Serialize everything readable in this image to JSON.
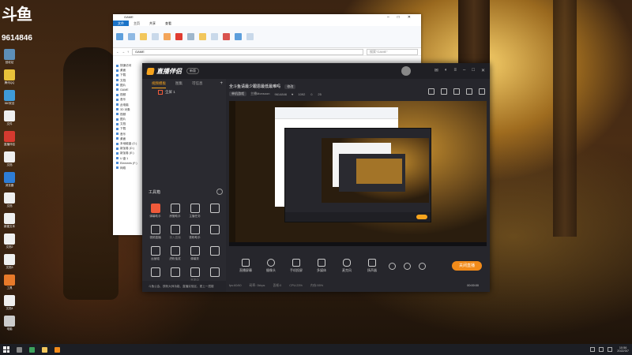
{
  "overlay": {
    "brand": "斗鱼",
    "room_id": "9614846"
  },
  "desktop_icons": [
    {
      "label": "回收站",
      "color": "#5d8fb8"
    },
    {
      "label": "腾讯QQ",
      "color": "#e8c13a"
    },
    {
      "label": "360安全",
      "color": "#3f9bd8"
    },
    {
      "label": "文件",
      "color": "#efefef"
    },
    {
      "label": "直播伴侣",
      "color": "#d63a2f"
    },
    {
      "label": "文档",
      "color": "#efefef"
    },
    {
      "label": "浏览器",
      "color": "#2e7dd6"
    },
    {
      "label": "文档",
      "color": "#efefef"
    },
    {
      "label": "新建文本",
      "color": "#efefef"
    },
    {
      "label": "文档2",
      "color": "#efefef"
    },
    {
      "label": "文档3",
      "color": "#efefef"
    },
    {
      "label": "工具",
      "color": "#e87a2a"
    },
    {
      "label": "文档4",
      "color": "#efefef"
    },
    {
      "label": "电脑",
      "color": "#cccccc"
    }
  ],
  "explorer": {
    "title": "GAME",
    "tabs": [
      "文件",
      "主页",
      "共享",
      "查看"
    ],
    "address": "GAME",
    "search_placeholder": "搜索\"GAME\"",
    "nav": [
      "快速访问",
      "桌面",
      "下载",
      "文档",
      "图片",
      "GAME",
      "视频",
      "音乐",
      "此电脑",
      "3D 对象",
      "视频",
      "图片",
      "文档",
      "下载",
      "音乐",
      "桌面",
      "本地磁盘 (C:)",
      "新加卷 (D:)",
      "新加卷 (E:)",
      "U 盘 1",
      "Elements (F:)",
      "网络"
    ]
  },
  "app": {
    "name": "直播伴侣",
    "version": "新版",
    "left_tabs": [
      "视频模板",
      "图集",
      "可信息"
    ],
    "scene_label": "全屏 1",
    "tools_title": "工具箱",
    "tools": [
      {
        "label": "弹幕助手",
        "hot": true,
        "dim": false
      },
      {
        "label": "房管助手",
        "hot": false,
        "dim": false
      },
      {
        "label": "主播任务",
        "hot": false,
        "dim": false
      },
      {
        "label": "",
        "hot": false,
        "dim": true
      },
      {
        "label": "视频直播",
        "hot": false,
        "dim": false
      },
      {
        "label": "录入直播",
        "hot": false,
        "dim": true
      },
      {
        "label": "铁粉助手",
        "hot": false,
        "dim": false
      },
      {
        "label": "",
        "hot": false,
        "dim": true
      },
      {
        "label": "运营喵",
        "hot": false,
        "dim": false
      },
      {
        "label": "虎粉抽奖",
        "hot": false,
        "dim": false
      },
      {
        "label": "弹幕秀",
        "hot": false,
        "dim": false
      },
      {
        "label": "",
        "hot": false,
        "dim": true
      },
      {
        "label": "",
        "hot": false,
        "dim": false
      },
      {
        "label": "",
        "hot": false,
        "dim": false
      },
      {
        "label": "开发中",
        "hot": false,
        "dim": true
      },
      {
        "label": "",
        "hot": false,
        "dim": true
      }
    ],
    "chat_text": "斗鱼公会、铁粉大师功能、直播实验区、更上一层楼",
    "room_title": "全斗鱼请最少跟恩最低最难吗",
    "edit_label": "修改",
    "category": "单机游戏",
    "streamer": "主播Monsoon",
    "room_no": "9614846",
    "followers": "1092",
    "online": "25",
    "bottom_tools": [
      "直播屏幕",
      "摄像头",
      "手机投屏",
      "多媒体",
      "麦克风",
      "扬声器"
    ],
    "live_button": "关闭直播",
    "status": [
      "fps:60/60",
      "码率: 0kbps",
      "丢帧:0",
      "CPU:23%",
      "内存:55%"
    ],
    "timer": "00:00:00"
  },
  "taskbar": {
    "time": "10:56",
    "date": "2022/3/7"
  }
}
